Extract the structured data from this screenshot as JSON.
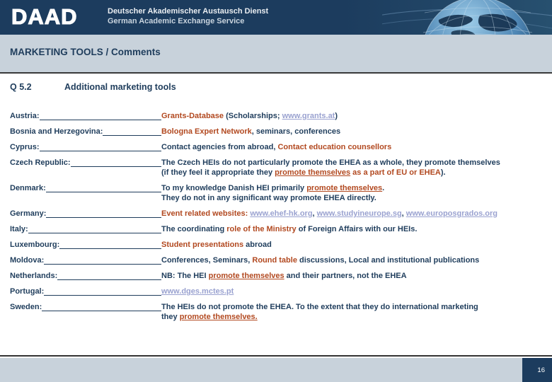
{
  "header": {
    "logo": "DAAD",
    "org_line1": "Deutscher Akademischer Austausch Dienst",
    "org_line2": "German Academic Exchange Service"
  },
  "title_bar": {
    "title": "MARKETING TOOLS / Comments"
  },
  "question": {
    "number": "Q 5.2",
    "label": "Additional marketing tools"
  },
  "colors": {
    "header_bg": "#1C3C5E",
    "band_bg": "#C8D2DB",
    "dark": "#1F3D5C",
    "accent": "#B24920",
    "link": "#9AA2D0"
  },
  "rows": [
    {
      "country": "Austria:",
      "lines": [
        [
          {
            "t": "Grants-Database",
            "s": "accent"
          },
          {
            "t": " (Scholarships; ",
            "s": "dark"
          },
          {
            "t": "www.grants.at",
            "s": "link"
          },
          {
            "t": ")",
            "s": "dark"
          }
        ]
      ]
    },
    {
      "country": "Bosnia and Herzegovina:",
      "lines": [
        [
          {
            "t": "Bologna Expert Network",
            "s": "accent"
          },
          {
            "t": ", seminars, conferences",
            "s": "dark"
          }
        ]
      ]
    },
    {
      "country": "Cyprus:",
      "lines": [
        [
          {
            "t": "Contact agencies from abroad, ",
            "s": "dark"
          },
          {
            "t": "Contact education counsellors",
            "s": "accent"
          }
        ]
      ]
    },
    {
      "country": "Czech Republic:",
      "lines": [
        [
          {
            "t": "The Czech HEIs do not particularly promote the EHEA as a whole, they promote themselves",
            "s": "dark"
          }
        ],
        [
          {
            "t": "(if they feel it appropriate they ",
            "s": "dark"
          },
          {
            "t": "promote themselves",
            "s": "accent-u"
          },
          {
            "t": " as a part of EU or EHEA",
            "s": "accent"
          },
          {
            "t": ").",
            "s": "dark"
          }
        ]
      ]
    },
    {
      "country": "Denmark:",
      "lines": [
        [
          {
            "t": "To my knowledge Danish HEI primarily ",
            "s": "dark"
          },
          {
            "t": "promote themselves",
            "s": "accent-u"
          },
          {
            "t": ".",
            "s": "dark"
          }
        ],
        [
          {
            "t": "They do not in any significant way promote EHEA directly.",
            "s": "dark"
          }
        ]
      ]
    },
    {
      "country": "Germany:",
      "lines": [
        [
          {
            "t": "Event related websites: ",
            "s": "accent"
          },
          {
            "t": "www.ehef-hk.org",
            "s": "link"
          },
          {
            "t": ", ",
            "s": "dark"
          },
          {
            "t": "www.studyineurope.sg",
            "s": "link"
          },
          {
            "t": ", ",
            "s": "dark"
          },
          {
            "t": "www.europosgrados.org",
            "s": "link"
          }
        ]
      ]
    },
    {
      "country": "Italy:",
      "lines": [
        [
          {
            "t": "The coordinating ",
            "s": "dark"
          },
          {
            "t": "role of the Ministry",
            "s": "accent"
          },
          {
            "t": " of Foreign Affairs with our HEIs.",
            "s": "dark"
          }
        ]
      ]
    },
    {
      "country": "Luxembourg:",
      "lines": [
        [
          {
            "t": "Student presentations",
            "s": "accent"
          },
          {
            "t": " abroad",
            "s": "dark"
          }
        ]
      ]
    },
    {
      "country": "Moldova:",
      "lines": [
        [
          {
            "t": "Conferences, Seminars, ",
            "s": "dark"
          },
          {
            "t": "Round table",
            "s": "accent"
          },
          {
            "t": " discussions, Local and institutional publications",
            "s": "dark"
          }
        ]
      ]
    },
    {
      "country": "Netherlands:",
      "lines": [
        [
          {
            "t": "NB: The HEI ",
            "s": "dark"
          },
          {
            "t": "promote themselves",
            "s": "accent-u"
          },
          {
            "t": " and their partners, not the EHEA",
            "s": "dark"
          }
        ]
      ]
    },
    {
      "country": "Portugal:",
      "lines": [
        [
          {
            "t": "www.dges.mctes.pt",
            "s": "link"
          }
        ]
      ]
    },
    {
      "country": "Sweden:",
      "lines": [
        [
          {
            "t": "The HEIs do not promote the EHEA. To the extent that they do international marketing",
            "s": "dark"
          }
        ],
        [
          {
            "t": "they ",
            "s": "dark"
          },
          {
            "t": "promote themselves.",
            "s": "accent-u"
          }
        ]
      ]
    }
  ],
  "footer": {
    "page_number": "16"
  }
}
